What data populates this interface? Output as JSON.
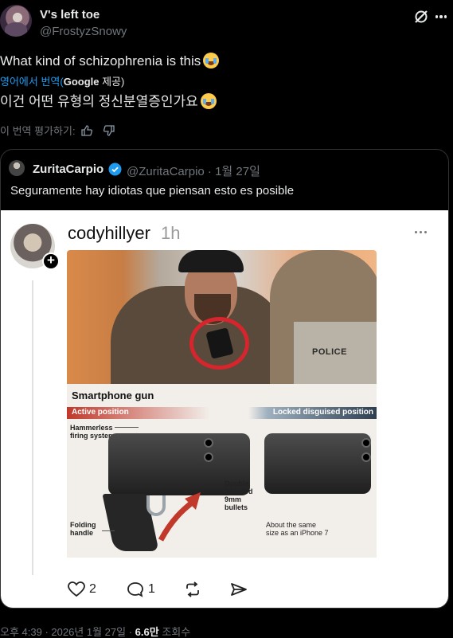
{
  "author": {
    "name": "V's left toe",
    "handle": "@FrostyzSnowy"
  },
  "tweet": {
    "text": "What kind of schizophrenia is this",
    "translated_label": "영어에서 번역(",
    "translated_provider": "Google",
    "translated_suffix": " 제공)",
    "translation": "이건 어떤 유형의 정신분열증인가요",
    "rate_label": "이 번역 평가하기:"
  },
  "quote": {
    "name": "ZuritaCarpio",
    "handle": "@ZuritaCarpio · 1월 27일",
    "text": "Seguramente hay idiotas que piensan esto es posible",
    "embed": {
      "username": "codyhillyer",
      "time": "1h",
      "photo_text": "POLICE",
      "info_title": "Smartphone gun",
      "active_label": "Active position",
      "locked_label": "Locked disguised position",
      "hammerless": "Hammerless firing system",
      "double_barreled": "Double barreled 9mm bullets",
      "folding": "Folding handle",
      "same_size": "About the same size as an iPhone 7",
      "likes": "2",
      "replies": "1"
    }
  },
  "footer": {
    "time": "오후 4:39 · 2026년 1월 27일 · ",
    "views": "6.6만",
    "views_label": " 조회수"
  }
}
